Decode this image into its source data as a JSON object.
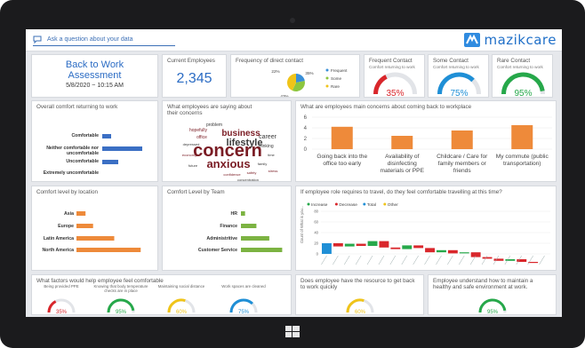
{
  "ask_prompt": "Ask a question about your data",
  "brand": "mazikcare",
  "assessment": {
    "title": "Back to Work Assessment",
    "datetime": "5/8/2020 ~ 10:15 AM"
  },
  "employees": {
    "label": "Current Employees",
    "value": "2,345"
  },
  "frequency": {
    "title": "Frequency of direct contact",
    "slices": [
      {
        "name": "Frequent",
        "value": 22,
        "color": "#3a8fd8",
        "label": "22%"
      },
      {
        "name": "Some",
        "value": 35,
        "color": "#8dc63f",
        "label": "35%"
      },
      {
        "name": "Rare",
        "value": 43,
        "color": "#f0c419",
        "label": "43%"
      }
    ]
  },
  "contact_gauges": [
    {
      "title": "Frequent Contact",
      "sub": "Comfort returning to work",
      "pct": "35%",
      "value": 0.35,
      "color": "#d9262b"
    },
    {
      "title": "Some Contact",
      "sub": "Comfort returning to work",
      "pct": "75%",
      "value": 0.75,
      "color": "#1f8fd6"
    },
    {
      "title": "Rare Contact",
      "sub": "Comfort returning to work",
      "pct": "95%",
      "value": 0.95,
      "color": "#26a84a"
    }
  ],
  "comfort_overall": {
    "title": "Overall comfort returning to work",
    "bars": [
      {
        "label": "Comfortable",
        "value": 10
      },
      {
        "label": "Neither comfortable nor uncomfortable",
        "value": 45
      },
      {
        "label": "Uncomfortable",
        "value": 18
      },
      {
        "label": "Extremely uncomfortable",
        "value": 0
      }
    ],
    "color": "#3b6fc4"
  },
  "wordcloud": {
    "title": "What employees are saying about their concerns",
    "words": [
      {
        "text": "concern",
        "size": 20,
        "color": "#7a1c24"
      },
      {
        "text": "anxious",
        "size": 13,
        "color": "#7a1c24"
      },
      {
        "text": "lifestyle",
        "size": 11,
        "color": "#3a3a3a"
      },
      {
        "text": "business",
        "size": 10,
        "color": "#7a1c24"
      },
      {
        "text": "career",
        "size": 7,
        "color": "#3a3a3a"
      },
      {
        "text": "hopefully",
        "size": 5,
        "color": "#7a1c24"
      },
      {
        "text": "problem",
        "size": 5,
        "color": "#3a3a3a"
      },
      {
        "text": "thinking",
        "size": 5,
        "color": "#3a3a3a"
      },
      {
        "text": "office",
        "size": 5,
        "color": "#7a1c24"
      },
      {
        "text": "depressed",
        "size": 4,
        "color": "#3a3a3a"
      },
      {
        "text": "safety",
        "size": 4,
        "color": "#7a1c24"
      },
      {
        "text": "time",
        "size": 4,
        "color": "#3a3a3a"
      },
      {
        "text": "economy",
        "size": 4,
        "color": "#7a1c24"
      },
      {
        "text": "family",
        "size": 4,
        "color": "#3a3a3a"
      },
      {
        "text": "confidence",
        "size": 4,
        "color": "#7a1c24"
      },
      {
        "text": "concentration",
        "size": 4,
        "color": "#3a3a3a"
      },
      {
        "text": "future",
        "size": 4,
        "color": "#3a3a3a"
      },
      {
        "text": "stress",
        "size": 4,
        "color": "#7a1c24"
      }
    ]
  },
  "concerns": {
    "title": "What are employees main concerns about coming back to workplace",
    "ticks": [
      "6",
      "4",
      "2",
      "0"
    ],
    "ymax": 6,
    "bars": [
      {
        "label": "Going back into the office too early",
        "value": 4.2
      },
      {
        "label": "Availability of disinfecting materials or PPE",
        "value": 2.5
      },
      {
        "label": "Childcare / Care for family members or friends",
        "value": 3.5
      },
      {
        "label": "My commute (public transportation)",
        "value": 4.5
      }
    ],
    "color": "#ee8a3a"
  },
  "location": {
    "title": "Comfort level by location",
    "bars": [
      {
        "label": "Asia",
        "value": 12
      },
      {
        "label": "Europe",
        "value": 22
      },
      {
        "label": "Latin America",
        "value": 50
      },
      {
        "label": "North America",
        "value": 85
      }
    ],
    "color": "#ee8a3a"
  },
  "team": {
    "title": "Comfort Level by Team",
    "bars": [
      {
        "label": "HR",
        "value": 8
      },
      {
        "label": "Finance",
        "value": 30
      },
      {
        "label": "Administritive",
        "value": 55
      },
      {
        "label": "Customer Service",
        "value": 80
      }
    ],
    "color": "#7cb342"
  },
  "travel": {
    "title": "If employee role requires to travel, do they feel comfortable travelling at this time?",
    "legend": [
      {
        "name": "Increase",
        "color": "#26a84a"
      },
      {
        "name": "Decrease",
        "color": "#d9262b"
      },
      {
        "name": "Total",
        "color": "#1f8fd6"
      },
      {
        "name": "Other",
        "color": "#f0c419"
      }
    ],
    "ylabel": "Count of What is you...",
    "ticks": [
      "80",
      "60",
      "40",
      "20",
      "0"
    ],
    "ymax": 80
  },
  "factors": {
    "title": "What factors would help employee feel comfortable",
    "items": [
      {
        "label": "Being provided PPE",
        "pct": "35%",
        "value": 0.35,
        "color": "#d9262b"
      },
      {
        "label": "Knowing that body temperature checks are in place",
        "pct": "95%",
        "value": 0.95,
        "color": "#26a84a"
      },
      {
        "label": "Maintaining social distance",
        "pct": "60%",
        "value": 0.6,
        "color": "#f0c419"
      },
      {
        "label": "Work spaces are cleaned",
        "pct": "75%",
        "value": 0.75,
        "color": "#1f8fd6"
      }
    ]
  },
  "resources": {
    "title": "Does employee have the resource to get back to work quickly",
    "pct": "60%",
    "value": 0.6,
    "color": "#f0c419"
  },
  "healthy": {
    "title": "Employee understand how to maintain a healthy and safe environment at work.",
    "pct": "95%",
    "value": 0.95,
    "color": "#26a84a"
  }
}
